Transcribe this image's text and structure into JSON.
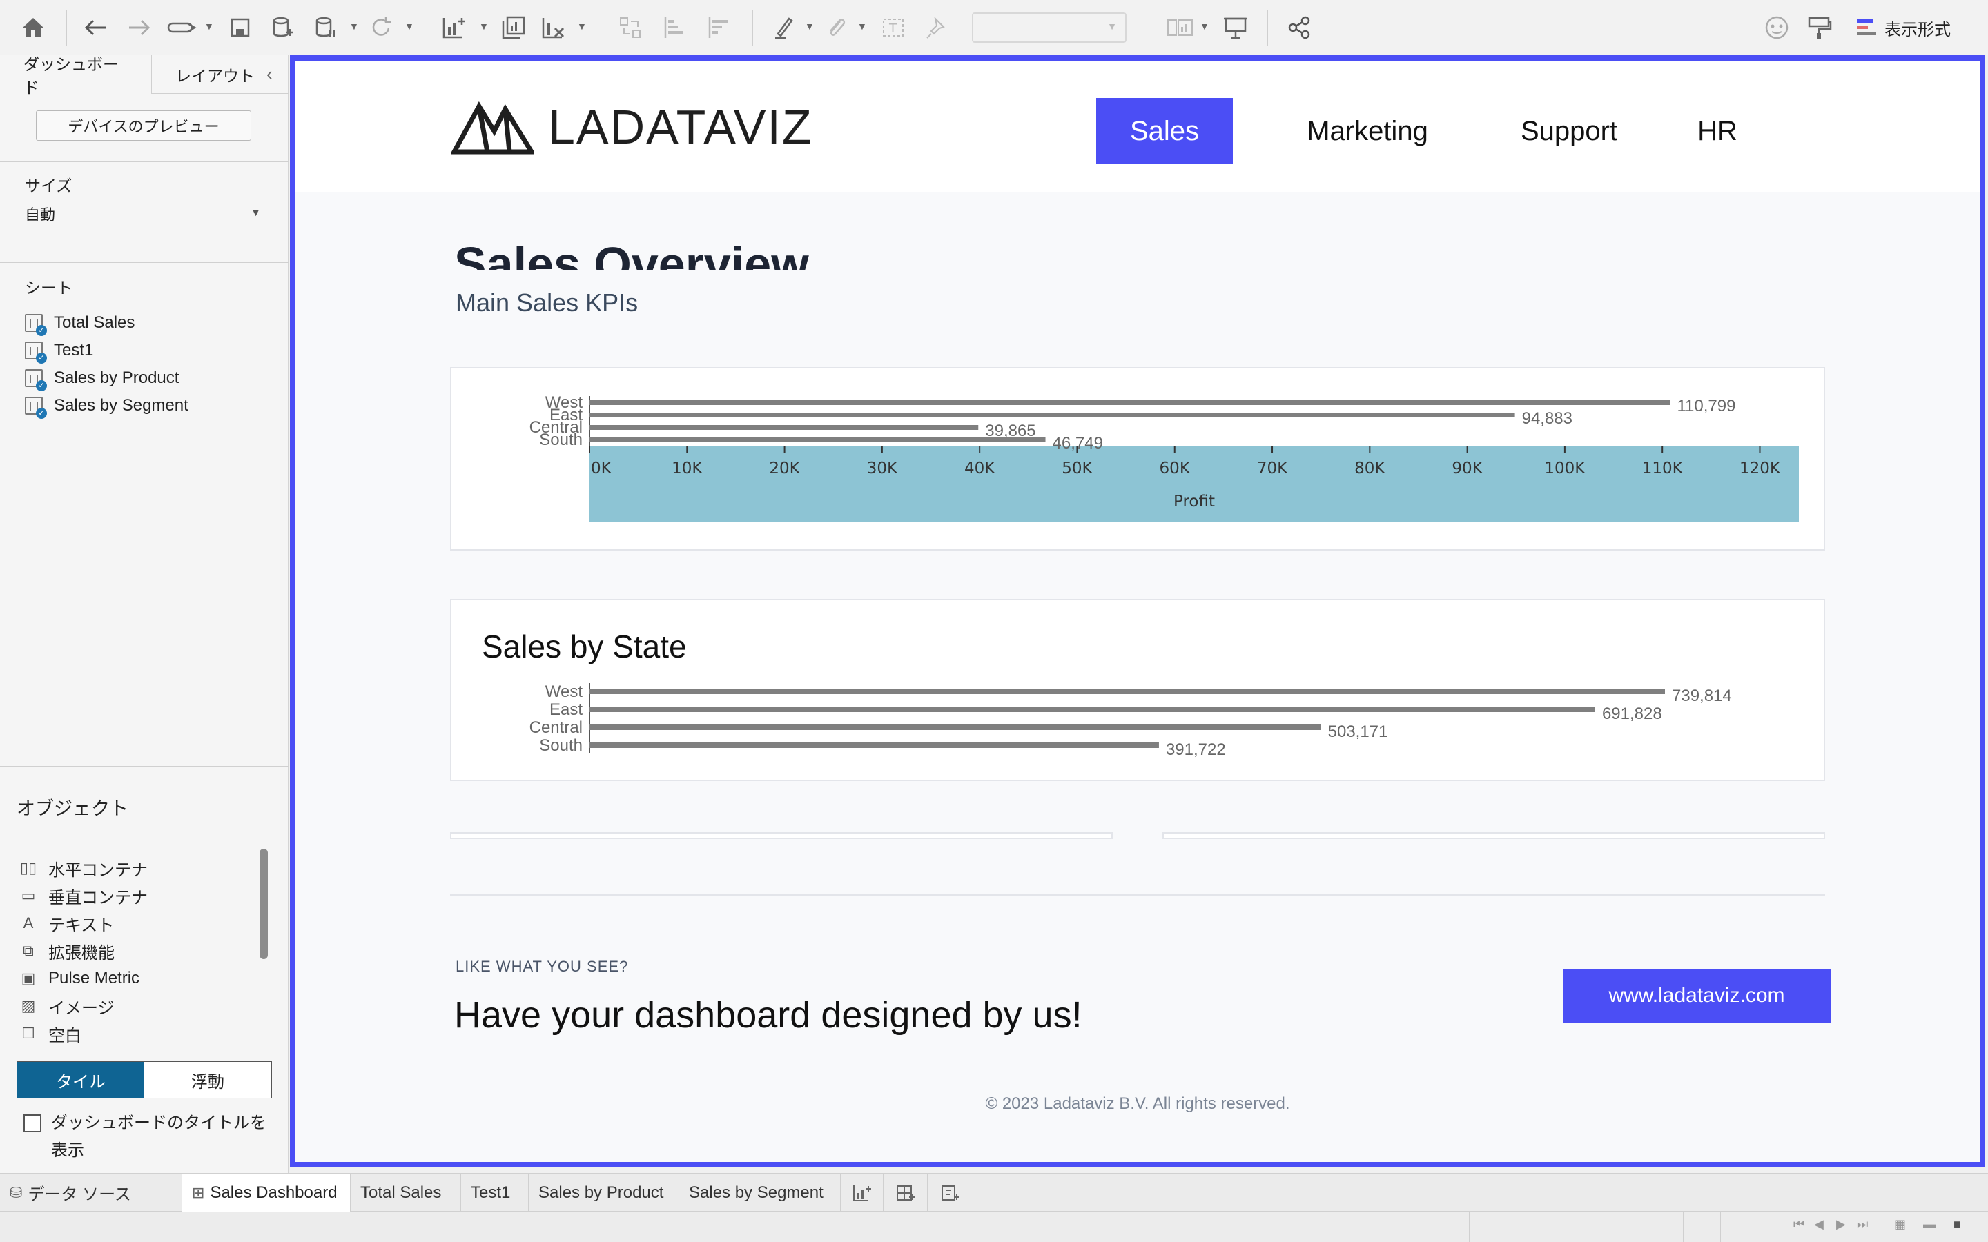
{
  "toolbar": {
    "format_label": "表示形式"
  },
  "left_pane": {
    "tabs": [
      "ダッシュボード",
      "レイアウト"
    ],
    "preview_button": "デバイスのプレビュー",
    "size_heading": "サイズ",
    "size_value": "自動",
    "sheets_heading": "シート",
    "sheets": [
      "Total Sales",
      "Test1",
      "Sales by Product",
      "Sales by Segment"
    ],
    "objects_heading": "オブジェクト",
    "objects": [
      "水平コンテナ",
      "垂直コンテナ",
      "テキスト",
      "拡張機能",
      "Pulse Metric",
      "イメージ",
      "空白"
    ],
    "tile_label": "タイル",
    "float_label": "浮動",
    "show_title_label": "ダッシュボードのタイトルを表示"
  },
  "dashboard": {
    "logo_text": "LADATAVIZ",
    "nav": [
      "Sales",
      "Marketing",
      "Support",
      "HR"
    ],
    "active_nav": "Sales",
    "title": "Sales Overview",
    "subtitle": "Main Sales KPIs",
    "state_card_title": "Sales by State",
    "cta_small": "LIKE WHAT YOU SEE?",
    "cta_big": "Have your dashboard designed by us!",
    "cta_button": "www.ladataviz.com",
    "copyright": "© 2023 Ladataviz B.V. All rights reserved.",
    "accent_color": "#4b4ef5"
  },
  "chart_data": [
    {
      "type": "bar",
      "orientation": "horizontal",
      "categories": [
        "West",
        "East",
        "Central",
        "South"
      ],
      "values": [
        110799,
        94883,
        39865,
        46749
      ],
      "value_labels": [
        "110,799",
        "94,883",
        "39,865",
        "46,749"
      ],
      "xlabel": "Profit",
      "xlim": [
        0,
        124000
      ],
      "ticks": [
        "0K",
        "10K",
        "20K",
        "30K",
        "40K",
        "50K",
        "60K",
        "70K",
        "80K",
        "90K",
        "100K",
        "110K",
        "120K"
      ],
      "bar_color": "#7f7f7f",
      "axis_band_color": "#8dc4d4"
    },
    {
      "type": "bar",
      "orientation": "horizontal",
      "title": "Sales by State",
      "categories": [
        "West",
        "East",
        "Central",
        "South"
      ],
      "values": [
        739814,
        691828,
        503171,
        391722
      ],
      "value_labels": [
        "739,814",
        "691,828",
        "503,171",
        "391,722"
      ],
      "xlim": [
        0,
        739814
      ],
      "bar_color": "#7f7f7f"
    }
  ],
  "sheet_tabs": {
    "data_source": "データ ソース",
    "tabs": [
      "Sales Dashboard",
      "Total Sales",
      "Test1",
      "Sales by Product",
      "Sales by Segment"
    ],
    "active": "Sales Dashboard"
  }
}
